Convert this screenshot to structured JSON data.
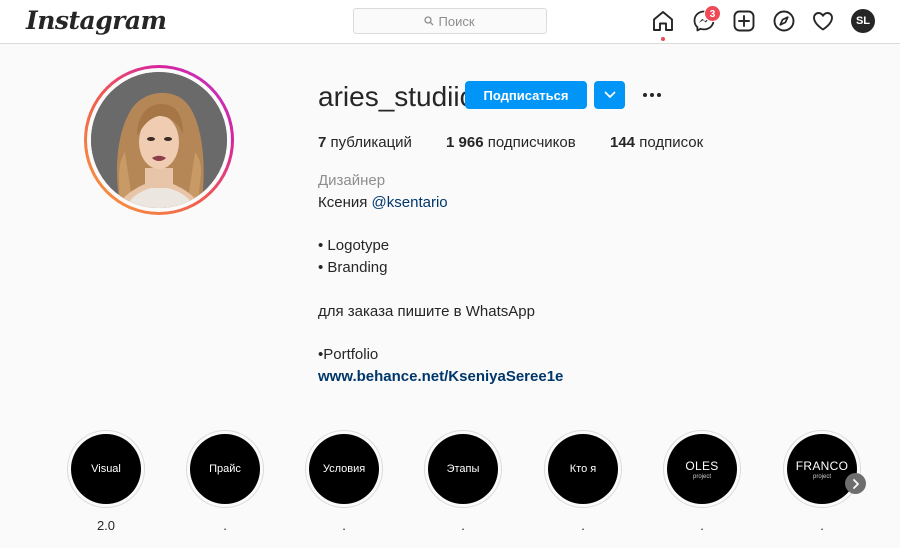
{
  "nav": {
    "logo": "Instagram",
    "search_placeholder": "Поиск",
    "messages_badge": "3",
    "user_initials": "SL",
    "icons": [
      "home-icon",
      "messenger-icon",
      "new-post-icon",
      "explore-icon",
      "activity-heart-icon"
    ]
  },
  "profile": {
    "username": "aries_studiio",
    "follow_label": "Подписаться",
    "stats": {
      "posts_count": "7",
      "posts_label": "публикаций",
      "followers_count": "1 966",
      "followers_label": "подписчиков",
      "following_count": "144",
      "following_label": "подписок"
    },
    "bio": {
      "category": "Дизайнер",
      "name": "Ксения",
      "mention": "@ksentario",
      "line_logotype": "• Logotype",
      "line_branding": "• Branding",
      "order_text": "для заказа пишите в WhatsApp",
      "portfolio": "•Portfolio",
      "link": "www.behance.net/KseniyaSeree1e"
    }
  },
  "highlights": [
    {
      "title": "Visual",
      "subtitle": "",
      "label": "2.0"
    },
    {
      "title": "Прайс",
      "subtitle": "",
      "label": "."
    },
    {
      "title": "Условия",
      "subtitle": "",
      "label": "."
    },
    {
      "title": "Этапы",
      "subtitle": "",
      "label": "."
    },
    {
      "title": "Кто я",
      "subtitle": "",
      "label": "."
    },
    {
      "title": "OLES",
      "subtitle": "project",
      "label": "."
    },
    {
      "title": "FRANCO",
      "subtitle": "project",
      "label": "."
    }
  ],
  "colors": {
    "accent": "#0095f6",
    "badge": "#ed4956",
    "link": "#00376b",
    "story_ring_start": "#f9a23a",
    "story_ring_end": "#b63ad6"
  }
}
